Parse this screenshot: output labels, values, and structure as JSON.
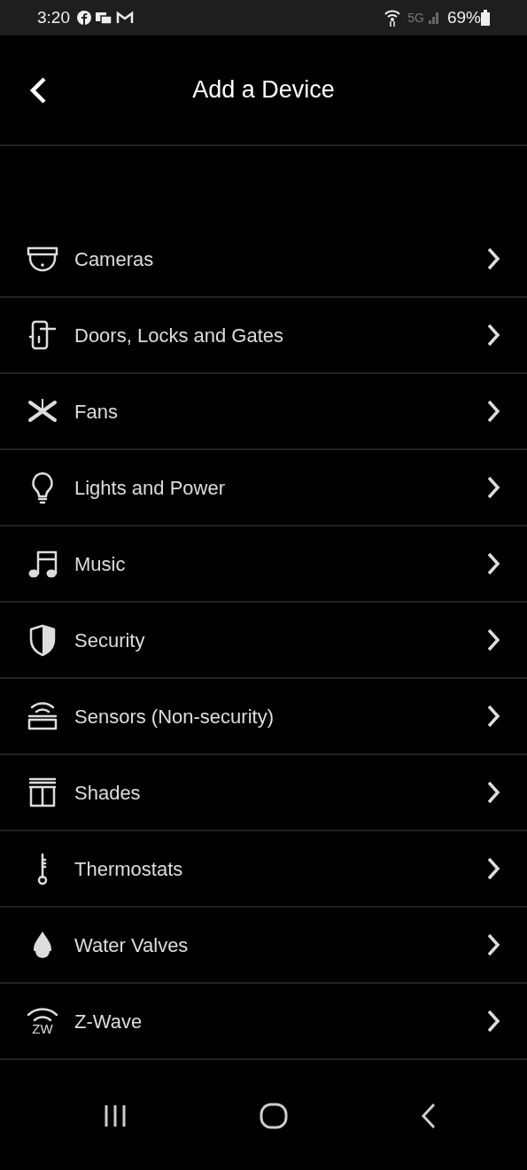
{
  "status_bar": {
    "time": "3:20",
    "network": "5G",
    "battery": "69%"
  },
  "header": {
    "title": "Add a Device"
  },
  "items": [
    {
      "kind": "camera",
      "label": "Cameras"
    },
    {
      "kind": "lock",
      "label": "Doors, Locks and Gates"
    },
    {
      "kind": "fan",
      "label": "Fans"
    },
    {
      "kind": "bulb",
      "label": "Lights and Power"
    },
    {
      "kind": "music",
      "label": "Music"
    },
    {
      "kind": "shield",
      "label": "Security"
    },
    {
      "kind": "sensor",
      "label": "Sensors (Non-security)"
    },
    {
      "kind": "shade",
      "label": "Shades"
    },
    {
      "kind": "thermometer",
      "label": "Thermostats"
    },
    {
      "kind": "drop",
      "label": "Water Valves"
    },
    {
      "kind": "zwave",
      "label": "Z-Wave",
      "icon_text": "ZW"
    }
  ]
}
